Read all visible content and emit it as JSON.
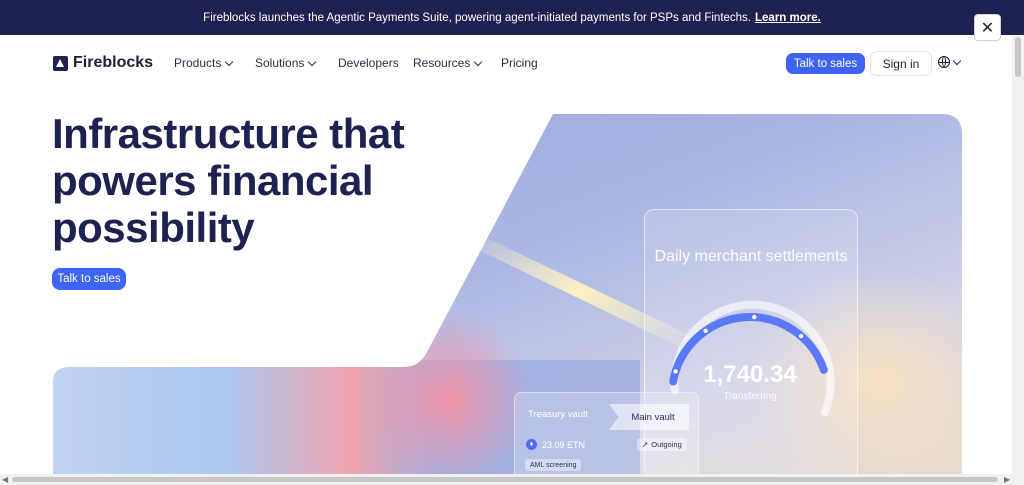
{
  "announcement": {
    "text": "Fireblocks launches the Agentic Payments Suite, powering agent-initiated payments for PSPs and Fintechs.",
    "link": "Learn more.",
    "close_icon": "close-icon"
  },
  "brand": {
    "name": "Fireblocks",
    "accent": "#3f63f5",
    "navy": "#1d2250"
  },
  "nav": {
    "items": [
      {
        "label": "Products",
        "dropdown": true
      },
      {
        "label": "Solutions",
        "dropdown": true
      },
      {
        "label": "Developers",
        "dropdown": false
      },
      {
        "label": "Resources",
        "dropdown": true
      },
      {
        "label": "Pricing",
        "dropdown": false
      }
    ],
    "cta": "Talk to sales",
    "signin": "Sign in",
    "language_icon": "globe-icon"
  },
  "hero": {
    "title": "Infrastructure that powers financial possibility",
    "cta": "Talk to sales"
  },
  "settlement_card": {
    "title": "Daily merchant settlements",
    "amount": "1,740.34",
    "status": "Transferring",
    "progress": 0.72
  },
  "vault_card": {
    "from": "Treasury vault",
    "to": "Main vault",
    "token_amount": "23.09 ETN",
    "direction": "Outgoing",
    "tag": "AML screening"
  }
}
